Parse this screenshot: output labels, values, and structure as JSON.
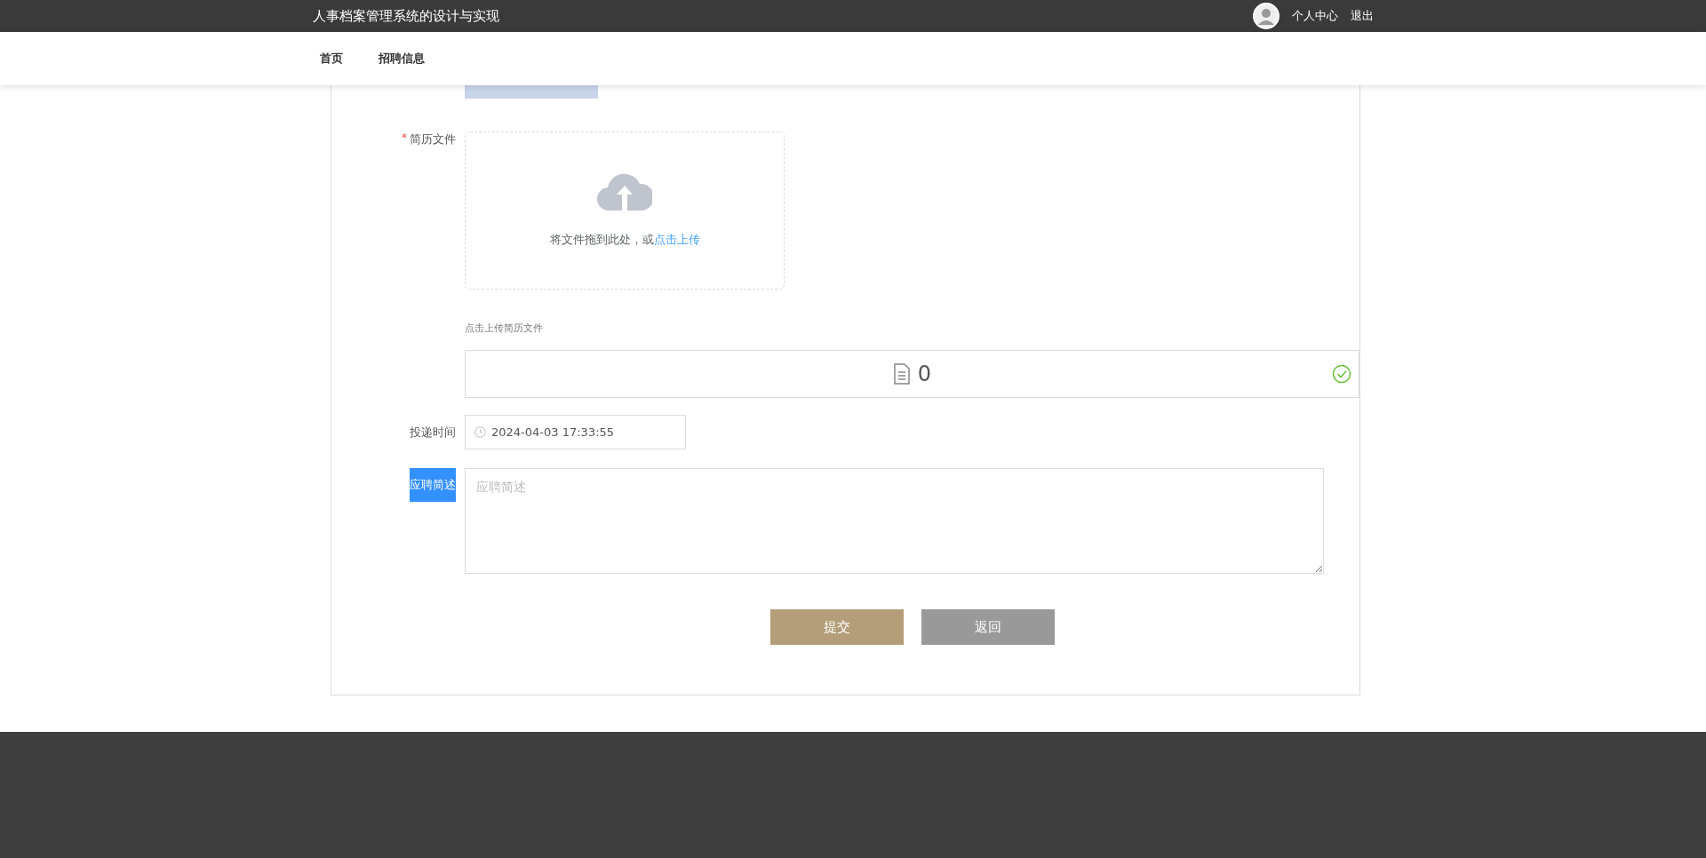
{
  "header": {
    "title": "人事档案管理系统的设计与实现",
    "links": [
      "个人中心",
      "退出"
    ]
  },
  "nav": {
    "items": [
      {
        "label": "首页",
        "selected": false
      },
      {
        "label": "招聘信息",
        "selected": false
      }
    ]
  },
  "form": {
    "resume": {
      "label": "简历文件",
      "required_mark": "*",
      "drop_text": "将文件拖到此处，或",
      "drop_link": "点击上传",
      "hint": "点击上传简历文件",
      "file_name": "0",
      "uploaded": true
    },
    "time": {
      "label": "投递时间",
      "value": "2024-04-03 17:33:55"
    },
    "summary": {
      "label": "应聘简述",
      "label_text_selected": true,
      "placeholder": "应聘简述"
    },
    "buttons": [
      {
        "label": "提交",
        "kind": "primary"
      },
      {
        "label": "返回",
        "kind": "secondary"
      }
    ]
  }
}
